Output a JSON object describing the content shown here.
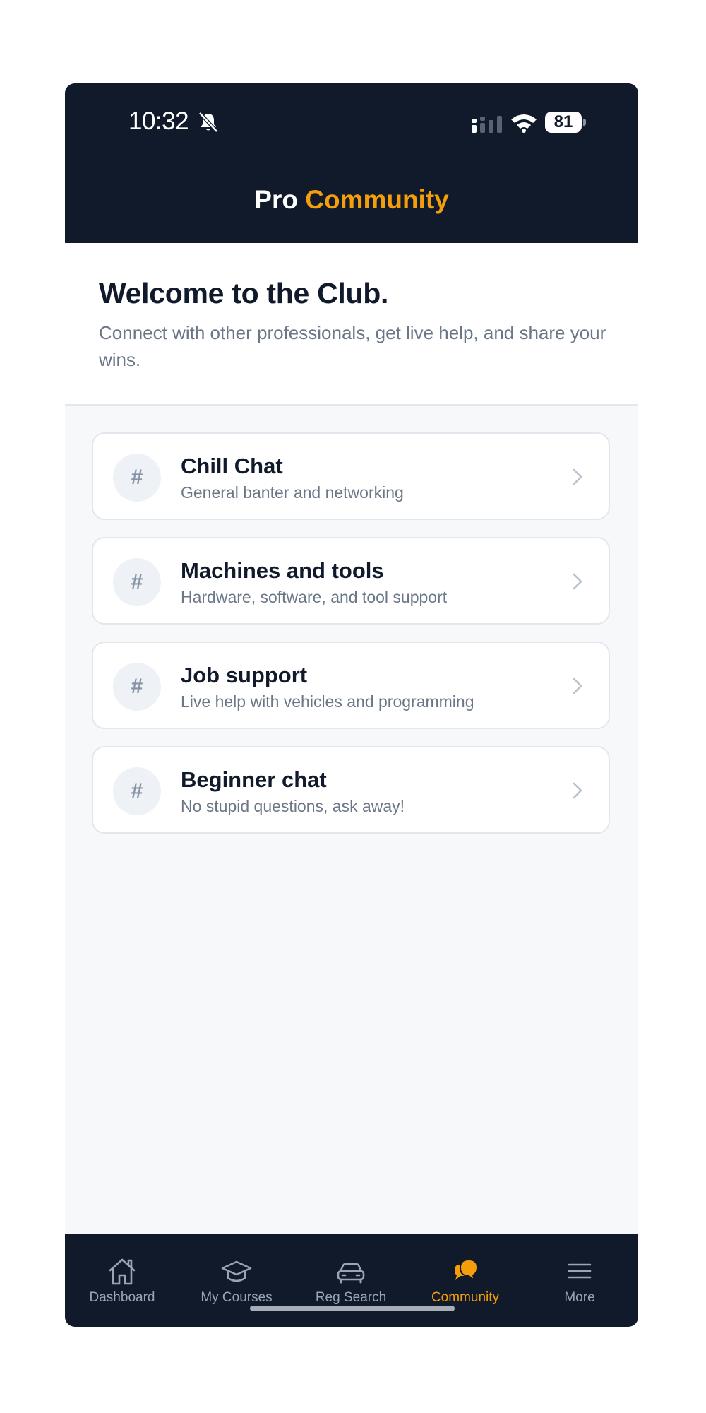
{
  "status_bar": {
    "time": "10:32",
    "battery": "81"
  },
  "header": {
    "brand_pro": "Pro",
    "brand_community": "Community"
  },
  "welcome": {
    "title": "Welcome to the Club.",
    "subtitle": "Connect with other professionals, get live help, and share your wins."
  },
  "channels": [
    {
      "icon": "#",
      "title": "Chill Chat",
      "subtitle": "General banter and networking"
    },
    {
      "icon": "#",
      "title": "Machines and tools",
      "subtitle": "Hardware, software, and tool support"
    },
    {
      "icon": "#",
      "title": "Job support",
      "subtitle": "Live help with vehicles and programming"
    },
    {
      "icon": "#",
      "title": "Beginner chat",
      "subtitle": "No stupid questions, ask away!"
    }
  ],
  "tabs": [
    {
      "label": "Dashboard",
      "icon": "home-icon"
    },
    {
      "label": "My Courses",
      "icon": "graduation-cap-icon"
    },
    {
      "label": "Reg Search",
      "icon": "car-icon"
    },
    {
      "label": "Community",
      "icon": "chat-bubbles-icon",
      "active": true
    },
    {
      "label": "More",
      "icon": "menu-icon"
    }
  ],
  "colors": {
    "brand_dark": "#111a2b",
    "accent": "#f59e0b",
    "muted_text": "#6b7787"
  }
}
